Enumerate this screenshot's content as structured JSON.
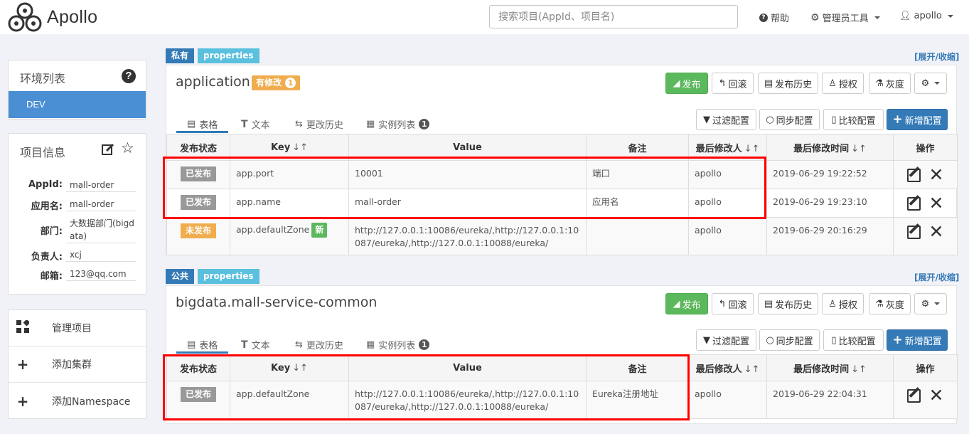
{
  "app": {
    "name": "Apollo"
  },
  "search": {
    "placeholder": "搜索项目(AppId、项目名)"
  },
  "nav": {
    "help": "帮助",
    "admin_tools": "管理员工具",
    "user": "apollo"
  },
  "env_panel": {
    "title": "环境列表",
    "envs": [
      "DEV"
    ]
  },
  "project_info": {
    "title": "项目信息",
    "fields": [
      {
        "label": "AppId:",
        "value": "mall-order"
      },
      {
        "label": "应用名:",
        "value": "mall-order"
      },
      {
        "label": "部门:",
        "value": "大数据部门(bigdata)"
      },
      {
        "label": "负责人:",
        "value": "xcj"
      },
      {
        "label": "邮箱:",
        "value": "123@qq.com"
      }
    ]
  },
  "sidebar_actions": [
    "管理项目",
    "添加集群",
    "添加Namespace"
  ],
  "toolbar": {
    "publish": "发布",
    "rollback": "回滚",
    "history": "发布历史",
    "authorize": "授权",
    "gray": "灰度"
  },
  "tabs": {
    "table": "表格",
    "text": "文本",
    "history": "更改历史",
    "instances": "实例列表",
    "instances_count": "1"
  },
  "table_actions": {
    "filter": "过滤配置",
    "sync": "同步配置",
    "compare": "比较配置",
    "add": "新增配置"
  },
  "columns": [
    "发布状态",
    "Key",
    "Value",
    "备注",
    "最后修改人",
    "最后修改时间",
    "操作"
  ],
  "expand_toggle": "[展开/收缩]",
  "namespaces": [
    {
      "scope": "私有",
      "format": "properties",
      "title": "application",
      "modified_label": "有修改",
      "modified_count": "1",
      "rows": [
        {
          "status": "已发布",
          "status_type": "published",
          "key": "app.port",
          "value": "10001",
          "comment": "端口",
          "modifier": "apollo",
          "time": "2019-06-29 19:22:52"
        },
        {
          "status": "已发布",
          "status_type": "published",
          "key": "app.name",
          "value": "mall-order",
          "comment": "应用名",
          "modifier": "apollo",
          "time": "2019-06-29 19:23:10"
        },
        {
          "status": "未发布",
          "status_type": "unpublished",
          "key": "app.defaultZone",
          "new_label": "新",
          "value": "http://127.0.0.1:10086/eureka/,http://127.0.0.1:10087/eureka/,http://127.0.0.1:10088/eureka/",
          "comment": "",
          "modifier": "apollo",
          "time": "2019-06-29 20:16:29"
        }
      ]
    },
    {
      "scope": "公共",
      "format": "properties",
      "title": "bigdata.mall-service-common",
      "rows": [
        {
          "status": "已发布",
          "status_type": "published",
          "key": "app.defaultZone",
          "value": "http://127.0.0.1:10086/eureka/,http://127.0.0.1:10087/eureka/,http://127.0.0.1:10088/eureka/",
          "comment": "Eureka注册地址",
          "modifier": "apollo",
          "time": "2019-06-29 22:04:31"
        }
      ]
    }
  ],
  "colors": {
    "primary": "#337ab7",
    "success": "#5cb85c",
    "warning": "#f0ad4e",
    "published": "#999999",
    "highlight": "#ff0000",
    "env_active": "#4a8fd3"
  }
}
